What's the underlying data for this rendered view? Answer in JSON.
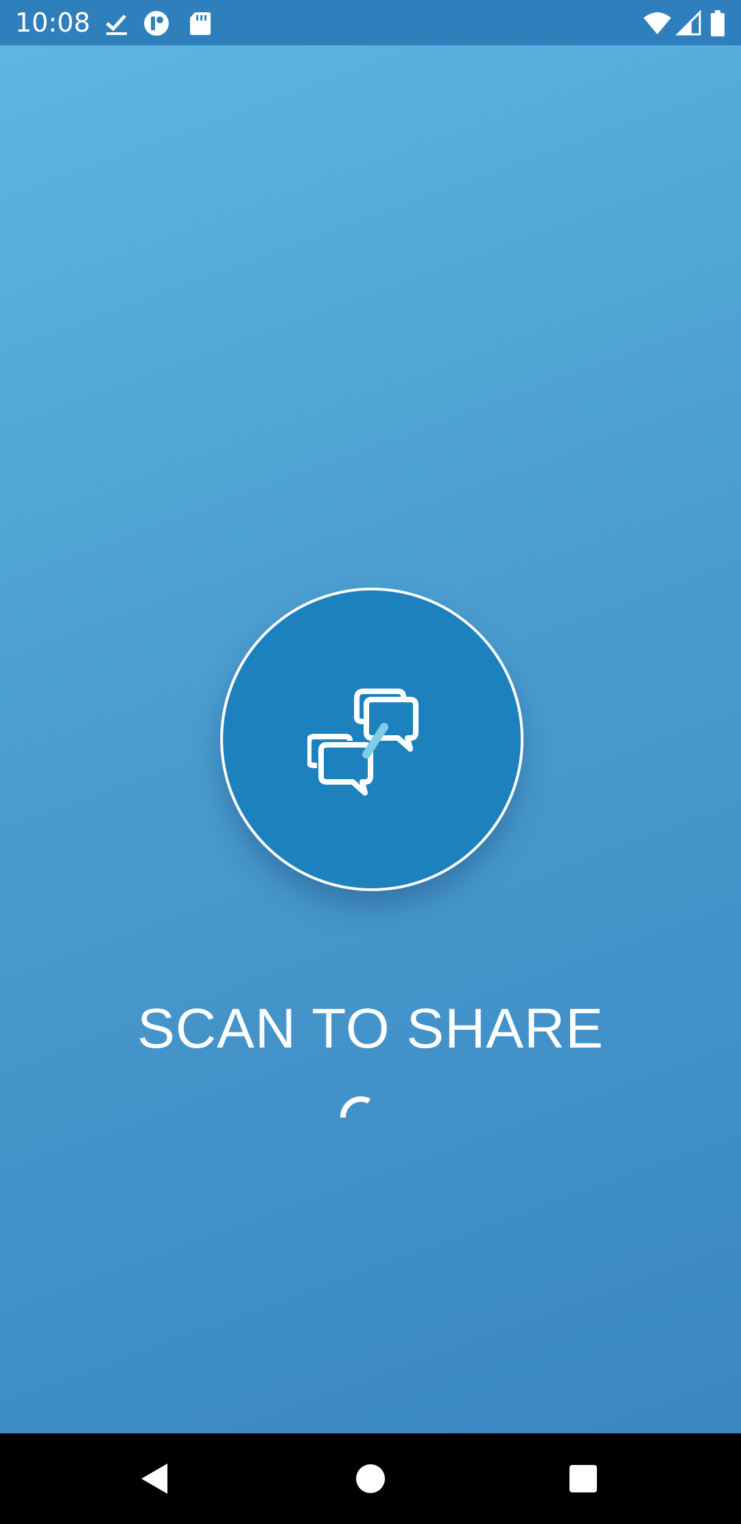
{
  "status_bar": {
    "time": "10:08",
    "icons_left": [
      "download-done-icon",
      "app-notification-icon",
      "sd-card-icon"
    ],
    "icons_right": [
      "wifi-icon",
      "cell-signal-icon",
      "battery-icon"
    ]
  },
  "main": {
    "logo_icon": "chat-bubbles-link-icon",
    "title": "SCAN TO SHARE",
    "loading_indicator": "spinner",
    "colors": {
      "gradient_top": "#5db6df",
      "gradient_bottom": "#3a86c2",
      "badge_fill": "#1c81bc",
      "badge_accent": "#7fcbe8"
    }
  },
  "navigation_bar": {
    "buttons": [
      "back-icon",
      "home-icon",
      "recents-icon"
    ]
  }
}
